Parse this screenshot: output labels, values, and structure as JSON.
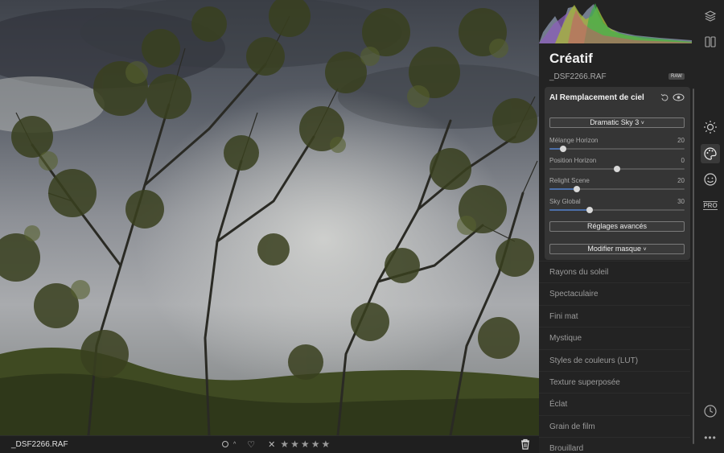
{
  "image": {
    "filename": "_DSF2266.RAF"
  },
  "bottombar": {
    "filename": "_DSF2266.RAF",
    "stars": [
      "★",
      "★",
      "★",
      "★",
      "★"
    ]
  },
  "panel": {
    "title": "Créatif",
    "file": "_DSF2266.RAF",
    "raw_badge": "RAW",
    "card": {
      "title": "AI Remplacement de ciel",
      "sky_select": "Dramatic Sky 3",
      "sliders": [
        {
          "label": "Mélange Horizon",
          "value": "20",
          "level": 0.1
        },
        {
          "label": "Position Horizon",
          "value": "0",
          "level": 0.5
        },
        {
          "label": "Relight Scene",
          "value": "20",
          "level": 0.2
        },
        {
          "label": "Sky Global",
          "value": "30",
          "level": 0.3
        }
      ],
      "advanced_button": "Réglages avancés",
      "mask_button": "Modifier masque"
    },
    "sections": [
      "Rayons du soleil",
      "Spectaculaire",
      "Fini mat",
      "Mystique",
      "Styles de couleurs (LUT)",
      "Texture superposée",
      "Éclat",
      "Grain de film",
      "Brouillard"
    ]
  },
  "toolbar": {
    "pro_label": "PRO"
  },
  "colors": {
    "accent": "#4c6fa8",
    "panel_bg": "#232323",
    "card_bg": "#353535"
  }
}
